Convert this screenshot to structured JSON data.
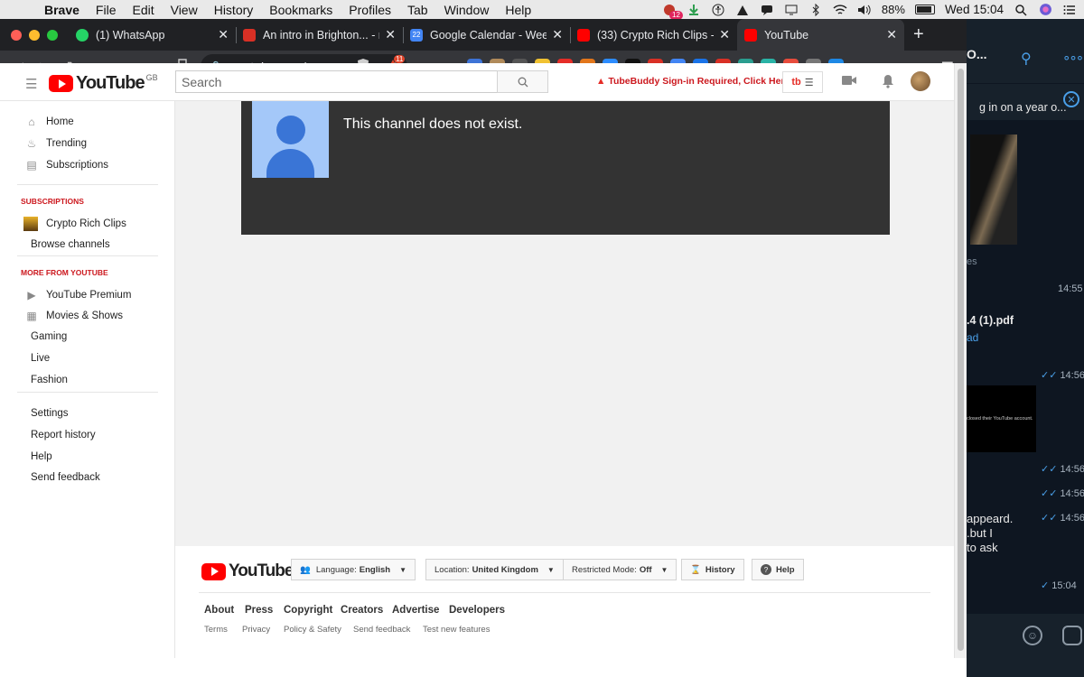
{
  "menubar": {
    "items": [
      "Brave",
      "File",
      "Edit",
      "View",
      "History",
      "Bookmarks",
      "Profiles",
      "Tab",
      "Window",
      "Help"
    ],
    "status_badge": "12",
    "battery": "88%",
    "clock": "Wed 15:04"
  },
  "tabs": [
    {
      "title": "(1) WhatsApp",
      "favicon": "whatsapp-icon",
      "color": "#25d366"
    },
    {
      "title": "An intro in Brighton... - rich",
      "favicon": "gmail-icon",
      "color": "#d93025"
    },
    {
      "title": "Google Calendar - Week o",
      "favicon": "calendar-icon",
      "color": "#4285f4",
      "fav_text": "22"
    },
    {
      "title": "(33) Crypto Rich Clips - Yo",
      "favicon": "youtube-icon",
      "color": "#ff0000"
    },
    {
      "title": "YouTube",
      "favicon": "youtube-icon",
      "color": "#ff0000",
      "active": true
    }
  ],
  "toolbar": {
    "url": "youtube.com/...",
    "brave_shield_count": "11",
    "ext_badge": "18",
    "extensions": [
      {
        "name": "grammarly-icon",
        "color": "#3d73d6",
        "label": ""
      },
      {
        "name": "cookie-icon",
        "color": "#b08a5a",
        "label": ""
      },
      {
        "name": "mountain-icon",
        "color": "#555",
        "label": ""
      },
      {
        "name": "sticky-icon",
        "color": "#f1c232",
        "label": ""
      },
      {
        "name": "tubebuddy-icon",
        "color": "#e52d27",
        "label": "tb"
      },
      {
        "name": "metamask-icon",
        "color": "#e2761b",
        "label": ""
      },
      {
        "name": "zoom-icon",
        "color": "#2d8cff",
        "label": ""
      },
      {
        "name": "hash-icon",
        "color": "#111",
        "label": "#"
      },
      {
        "name": "tag-icon",
        "color": "#d93025",
        "label": ""
      },
      {
        "name": "translate-icon",
        "color": "#4285f4",
        "label": "G"
      },
      {
        "name": "m-icon",
        "color": "#1a73e8",
        "label": "M"
      },
      {
        "name": "arrow-icon",
        "color": "#d93025",
        "label": ""
      },
      {
        "name": "react-icon",
        "color": "#2a9d8f",
        "label": ""
      },
      {
        "name": "g-icon",
        "color": "#2ab3a6",
        "label": "g"
      },
      {
        "name": "pokeball-icon",
        "color": "#e74c3c",
        "label": ""
      },
      {
        "name": "copy-icon",
        "color": "#777",
        "label": ""
      },
      {
        "name": "s-icon",
        "color": "#1e88e5",
        "label": "S"
      }
    ]
  },
  "youtube": {
    "logo_text": "YouTube",
    "logo_region": "GB",
    "search_placeholder": "Search",
    "tubebuddy_warning": "TubeBuddy Sign-in Required, Click Here",
    "tubebuddy_btn": "tb",
    "guide": {
      "main": [
        {
          "label": "Home",
          "icon": "home-icon"
        },
        {
          "label": "Trending",
          "icon": "flame-icon"
        },
        {
          "label": "Subscriptions",
          "icon": "subscriptions-icon"
        }
      ],
      "subscriptions_header": "SUBSCRIPTIONS",
      "subscriptions": [
        "Crypto Rich Clips",
        "Browse channels"
      ],
      "more_header": "MORE FROM YOUTUBE",
      "more": [
        {
          "label": "YouTube Premium",
          "icon": "youtube-premium-icon"
        },
        {
          "label": "Movies & Shows",
          "icon": "film-icon"
        },
        {
          "label": "Gaming"
        },
        {
          "label": "Live"
        },
        {
          "label": "Fashion"
        }
      ],
      "settings": [
        "Settings",
        "Report history",
        "Help",
        "Send feedback"
      ]
    },
    "channel_message": "This channel does not exist.",
    "footer": {
      "language_label": "Language:",
      "language_value": "English",
      "location_label": "Location:",
      "location_value": "United Kingdom",
      "restricted_label": "Restricted Mode:",
      "restricted_value": "Off",
      "history_btn": "History",
      "help_btn": "Help",
      "links": [
        "About",
        "Press",
        "Copyright",
        "Creators",
        "Advertise",
        "Developers"
      ],
      "sublinks": [
        "Terms",
        "Privacy",
        "Policy & Safety",
        "Send feedback",
        "Test new features"
      ]
    }
  },
  "telegram": {
    "title": "O...",
    "pinned": "g in on a year o...",
    "separator": "es",
    "times": [
      "14:55",
      "14:56",
      "14:56",
      "14:56",
      "14:56",
      "15:04"
    ],
    "file_name": ".4 (1).pdf",
    "download_label": "ad",
    "dark_msg": "closed their YouTube account.",
    "msg_lines": [
      "appeard.",
      ".but I",
      "to ask"
    ]
  }
}
